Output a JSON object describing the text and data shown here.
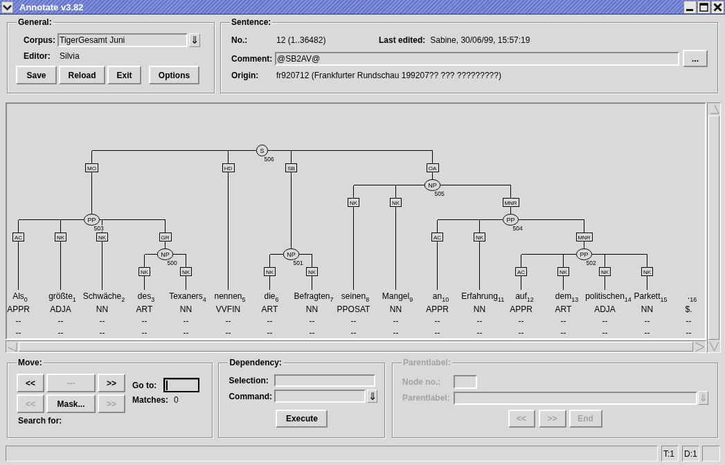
{
  "window": {
    "title": "Annotate v3.82"
  },
  "general": {
    "legend": "General:",
    "corpus": {
      "label": "Corpus:",
      "value": "TigerGesamt Juni",
      "button": "⇓"
    },
    "editor": {
      "label": "Editor:",
      "value": "Silvia"
    },
    "buttons": [
      {
        "label": "Save"
      },
      {
        "label": "Reload"
      },
      {
        "label": "Exit"
      },
      {
        "label": "Options"
      }
    ]
  },
  "sentence": {
    "legend": "Sentence:",
    "number": {
      "label": "No.:",
      "value": "12 (1..36482)"
    },
    "last_edited": {
      "label": "Last edited:",
      "value": "Sabine, 30/06/99, 15:57:19"
    },
    "comment": {
      "label": "Comment:",
      "value": "@SB2AV@",
      "button": "..."
    },
    "origin": {
      "label": "Origin:",
      "value": "fr920712 (Frankfurter Rundschau 199207?? ??? ?????????)"
    }
  },
  "tree": {
    "root": {
      "label": "S",
      "number": "506",
      "children": [
        {
          "edge": "MO",
          "label": "PP",
          "number": "503",
          "children": [
            {
              "edge": "AC",
              "word": "Als",
              "index": "0",
              "tag": "APPR",
              "lines": [
                "--",
                "--"
              ]
            },
            {
              "edge": "NK",
              "word": "größte",
              "index": "1",
              "tag": "ADJA",
              "lines": [
                "--",
                "--"
              ]
            },
            {
              "edge": "NK",
              "word": "Schwäche",
              "index": "2",
              "tag": "NN",
              "lines": [
                "--",
                "--"
              ]
            },
            {
              "edge": "GR",
              "label": "NP",
              "number": "500",
              "children": [
                {
                  "edge": "NK",
                  "word": "des",
                  "index": "3",
                  "tag": "ART",
                  "lines": [
                    "--",
                    "--"
                  ]
                },
                {
                  "edge": "NK",
                  "word": "Texaners",
                  "index": "4",
                  "tag": "NN",
                  "lines": [
                    "--",
                    "--"
                  ]
                }
              ]
            }
          ]
        },
        {
          "edge": "HD",
          "word": "nennen",
          "index": "5",
          "tag": "VVFIN",
          "lines": [
            "--",
            "--"
          ]
        },
        {
          "edge": "SB",
          "label": "NP",
          "number": "501",
          "children": [
            {
              "edge": "NK",
              "word": "die",
              "index": "6",
              "tag": "ART",
              "lines": [
                "--",
                "--"
              ]
            },
            {
              "edge": "NK",
              "word": "Befragten",
              "index": "7",
              "tag": "NN",
              "lines": [
                "--",
                "--"
              ]
            }
          ]
        },
        {
          "edge": "OA",
          "label": "NP",
          "number": "505",
          "children": [
            {
              "edge": "NK",
              "word": "seinen",
              "index": "8",
              "tag": "PPOSAT",
              "lines": [
                "--",
                "--"
              ]
            },
            {
              "edge": "NK",
              "word": "Mangel",
              "index": "9",
              "tag": "NN",
              "lines": [
                "--",
                "--"
              ]
            },
            {
              "edge": "MNR",
              "label": "PP",
              "number": "504",
              "children": [
                {
                  "edge": "AC",
                  "word": "an",
                  "index": "10",
                  "tag": "APPR",
                  "lines": [
                    "--",
                    "--"
                  ]
                },
                {
                  "edge": "NK",
                  "word": "Erfahrung",
                  "index": "11",
                  "tag": "NN",
                  "lines": [
                    "--",
                    "--"
                  ]
                },
                {
                  "edge": "MNR",
                  "label": "PP",
                  "number": "502",
                  "children": [
                    {
                      "edge": "AC",
                      "word": "auf",
                      "index": "12",
                      "tag": "APPR",
                      "lines": [
                        "--",
                        "--"
                      ]
                    },
                    {
                      "edge": "NK",
                      "word": "dem",
                      "index": "13",
                      "tag": "ART",
                      "lines": [
                        "--",
                        "--"
                      ]
                    },
                    {
                      "edge": "NK",
                      "word": "politischen",
                      "index": "14",
                      "tag": "ADJA",
                      "lines": [
                        "--",
                        "--"
                      ]
                    },
                    {
                      "edge": "NK",
                      "word": "Parkett",
                      "index": "15",
                      "tag": "NN",
                      "lines": [
                        "--",
                        "--"
                      ]
                    }
                  ]
                }
              ]
            }
          ]
        }
      ]
    },
    "unattached": [
      {
        "word": ".",
        "index": "16",
        "tag": "$.",
        "lines": [
          "--",
          "--"
        ]
      }
    ]
  },
  "move": {
    "legend": "Move:",
    "buttons": [
      {
        "label": "<<",
        "disabled": false
      },
      {
        "label": "---",
        "disabled": true
      },
      {
        "label": ">>",
        "disabled": false
      },
      {
        "label": "<<",
        "disabled": true
      },
      {
        "label": "Mask...",
        "disabled": false
      },
      {
        "label": ">>",
        "disabled": true
      }
    ],
    "goto": {
      "label": "Go to:",
      "focused": true
    },
    "matches": {
      "label": "Matches:",
      "value": "0"
    },
    "search": {
      "label": "Search for:"
    }
  },
  "dependency": {
    "legend": "Dependency:",
    "selection": {
      "label": "Selection:"
    },
    "command": {
      "label": "Command:",
      "button": "⇓"
    },
    "execute": {
      "label": "Execute",
      "disabled": false
    }
  },
  "parentlabel": {
    "legend": "Parentlabel:",
    "disabled": true,
    "node_no": {
      "label": "Node no.:"
    },
    "parent_label": {
      "label": "Parentlabel:",
      "button": "⇓"
    },
    "buttons": [
      {
        "label": "<<",
        "disabled": true
      },
      {
        "label": ">>",
        "disabled": true
      },
      {
        "label": "End",
        "disabled": true
      }
    ]
  },
  "status_bar": {
    "fields": [
      "T:1",
      "D:1"
    ]
  }
}
